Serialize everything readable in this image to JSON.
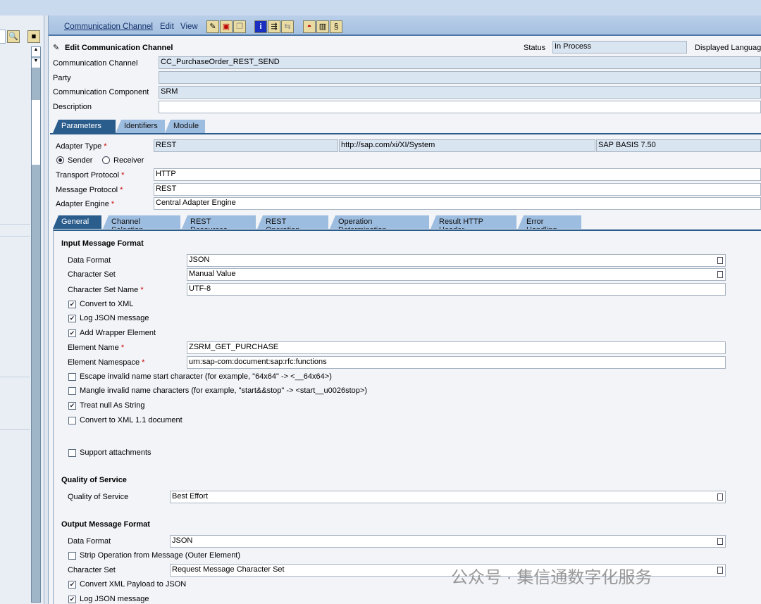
{
  "menu": {
    "items": [
      "Communication Channel",
      "Edit",
      "View"
    ]
  },
  "toolbar_icons": [
    "edit-icon",
    "save-icon",
    "copy-icon",
    "info-icon",
    "where-used-icon",
    "compare-icon",
    "hat-icon",
    "book-icon",
    "scroll-icon"
  ],
  "header": {
    "title": "Edit Communication Channel",
    "status_label": "Status",
    "status_value": "In Process",
    "displayed_language_label": "Displayed Languag"
  },
  "fields": {
    "channel": {
      "label": "Communication Channel",
      "value": "CC_PurchaseOrder_REST_SEND"
    },
    "party": {
      "label": "Party",
      "value": ""
    },
    "component": {
      "label": "Communication Component",
      "value": "SRM"
    },
    "description": {
      "label": "Description",
      "value": ""
    }
  },
  "tabs": [
    "Parameters",
    "Identifiers",
    "Module"
  ],
  "params": {
    "adapter_type_label": "Adapter Type",
    "adapter_type": "REST",
    "adapter_ns": "http://sap.com/xi/XI/System",
    "adapter_swcv": "SAP BASIS 7.50",
    "sender": "Sender",
    "receiver": "Receiver",
    "transport_label": "Transport Protocol",
    "transport": "HTTP",
    "message_label": "Message Protocol",
    "message": "REST",
    "engine_label": "Adapter Engine",
    "engine": "Central Adapter Engine"
  },
  "subtabs": [
    "General",
    "Channel Selection",
    "REST Resources",
    "REST Operation",
    "Operation Determination",
    "Result HTTP Header",
    "Error Handling"
  ],
  "input": {
    "heading": "Input Message Format",
    "data_format_label": "Data Format",
    "data_format": "JSON",
    "charset_label": "Character Set",
    "charset": "Manual Value",
    "charset_name_label": "Character Set Name",
    "charset_name": "UTF-8",
    "convert_xml": "Convert to XML",
    "log_json": "Log JSON message",
    "add_wrapper": "Add Wrapper Element",
    "element_name_label": "Element Name",
    "element_name": "ZSRM_GET_PURCHASE",
    "element_ns_label": "Element Namespace",
    "element_ns": "urn:sap-com:document:sap:rfc:functions",
    "escape": "Escape invalid name start character (for example, \"64x64\" -> <__64x64>)",
    "mangle": "Mangle invalid name characters (for example, \"start&&stop\" -> <start__u0026stop>)",
    "treat_null": "Treat null As String",
    "xml11": "Convert to XML 1.1 document",
    "attachments": "Support attachments"
  },
  "qos": {
    "heading": "Quality of Service",
    "label": "Quality of Service",
    "value": "Best Effort"
  },
  "output": {
    "heading": "Output Message Format",
    "data_format_label": "Data Format",
    "data_format": "JSON",
    "strip": "Strip Operation from Message (Outer Element)",
    "charset_label": "Character Set",
    "charset": "Request Message Character Set",
    "convert_json": "Convert XML Payload to JSON",
    "log_json": "Log JSON message"
  },
  "watermark": "公众号 · 集信通数字化服务"
}
